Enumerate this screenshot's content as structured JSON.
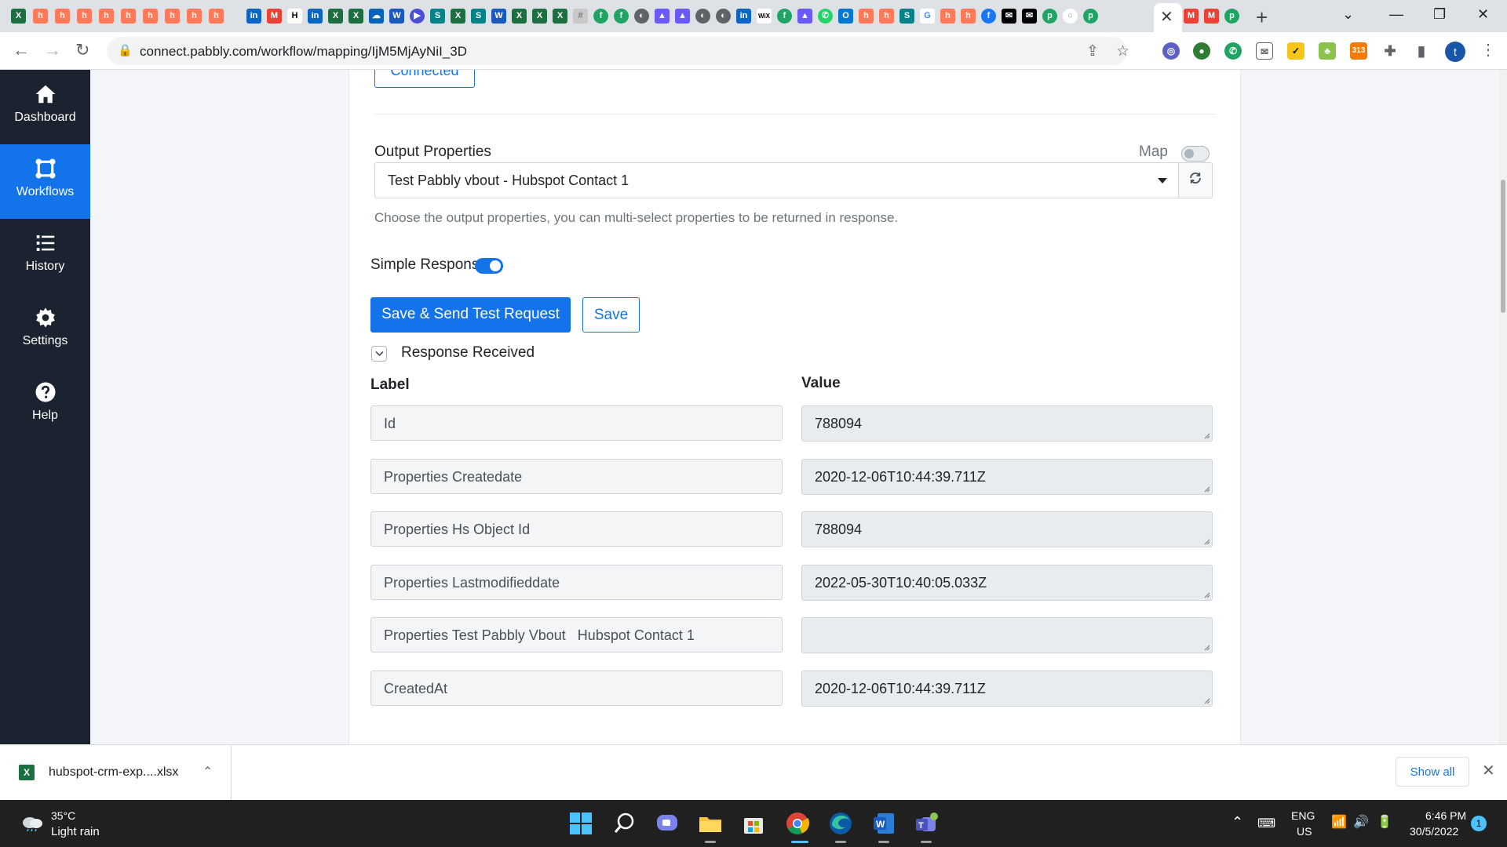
{
  "browser": {
    "url": "connect.pabbly.com/workflow/mapping/IjM5MjAyNiI_3D",
    "profile_initial": "t",
    "extension_badge": "313"
  },
  "sidebar": {
    "items": [
      {
        "label": "Dashboard",
        "icon": "home-icon"
      },
      {
        "label": "Workflows",
        "icon": "workflows-icon",
        "active": true
      },
      {
        "label": "History",
        "icon": "history-icon"
      },
      {
        "label": "Settings",
        "icon": "gear-icon"
      },
      {
        "label": "Help",
        "icon": "help-icon"
      }
    ]
  },
  "main": {
    "connected_label": "Connected",
    "output_properties_label": "Output Properties",
    "map_label": "Map",
    "output_select_value": "Test Pabbly vbout - Hubspot Contact 1",
    "output_help": "Choose the output properties, you can multi-select properties to be returned in response.",
    "simple_response_label": "Simple Response",
    "save_send_label": "Save & Send Test Request",
    "save_label": "Save",
    "response_received_label": "Response Received",
    "col_label": "Label",
    "col_value": "Value",
    "rows": [
      {
        "label": "Id",
        "value": "788094"
      },
      {
        "label": "Properties Createdate",
        "value": "2020-12-06T10:44:39.711Z"
      },
      {
        "label": "Properties Hs Object Id",
        "value": "788094"
      },
      {
        "label": "Properties Lastmodifieddate",
        "value": "2022-05-30T10:40:05.033Z"
      },
      {
        "label": "Properties Test Pabbly Vbout   Hubspot Contact 1",
        "value": ""
      },
      {
        "label": "CreatedAt",
        "value": "2020-12-06T10:44:39.711Z"
      }
    ]
  },
  "download": {
    "filename": "hubspot-crm-exp....xlsx",
    "show_all": "Show all"
  },
  "taskbar": {
    "temperature": "35°C",
    "weather": "Light rain",
    "lang_1": "ENG",
    "lang_2": "US",
    "time": "6:46 PM",
    "date": "30/5/2022",
    "notifications": "1"
  },
  "colors": {
    "accent": "#1273eb",
    "sidebar_bg": "#1c2330"
  }
}
